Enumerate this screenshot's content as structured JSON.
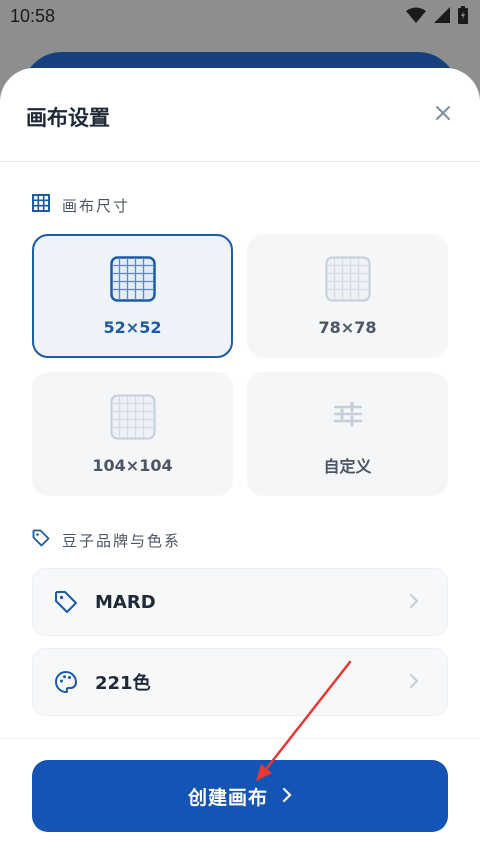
{
  "status_bar": {
    "time": "10:58"
  },
  "sheet": {
    "title": "画布设置",
    "canvas_size_section": {
      "label": "画布尺寸",
      "options": [
        {
          "label": "52×52",
          "selected": true
        },
        {
          "label": "78×78",
          "selected": false
        },
        {
          "label": "104×104",
          "selected": false
        },
        {
          "label": "自定义",
          "selected": false
        }
      ]
    },
    "brand_section": {
      "label": "豆子品牌与色系",
      "brand_value": "MARD",
      "palette_value": "221色"
    },
    "create_button": {
      "label": "创建画布"
    }
  },
  "colors": {
    "accent": "#1454b4",
    "selected_border": "#1f5aa6",
    "annotation_arrow": "#e53935"
  }
}
